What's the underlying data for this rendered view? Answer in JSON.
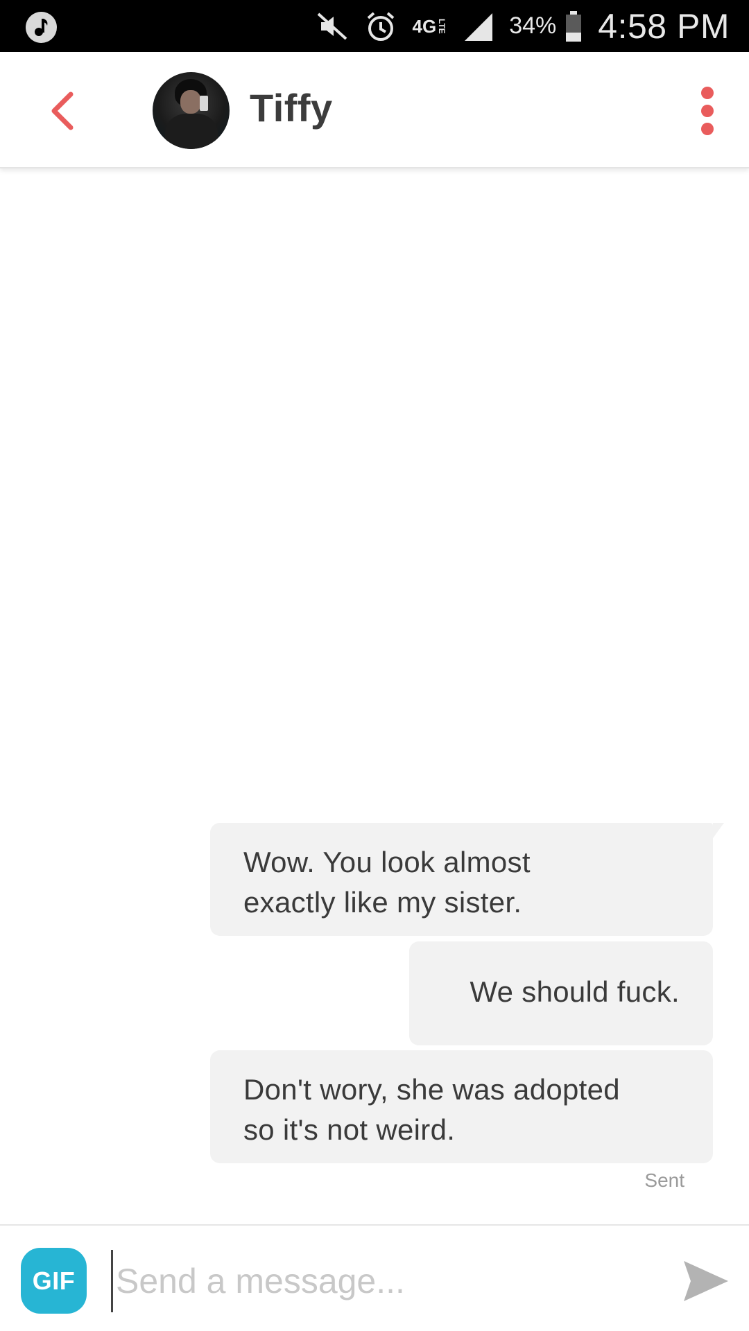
{
  "status_bar": {
    "music_icon": "music-note-icon",
    "mute_icon": "mute-icon",
    "alarm_icon": "alarm-icon",
    "network_label": "4G",
    "network_sub": "LTE",
    "signal_icon": "signal-icon",
    "battery_percent": "34%",
    "battery_level": 0.34,
    "time": "4:58 PM"
  },
  "header": {
    "back_icon": "chevron-left-icon",
    "contact_name": "Tiffy",
    "menu_icon": "more-vertical-icon"
  },
  "messages": [
    {
      "text_line1": "Wow. You look almost",
      "text_line2": "exactly like my sister."
    },
    {
      "text_line1": "We should fuck."
    },
    {
      "text_line1": "Don't wory, she was adopted",
      "text_line2": "so it's not weird."
    }
  ],
  "sent_label": "Sent",
  "composer": {
    "gif_label": "GIF",
    "placeholder": "Send a message...",
    "value": "",
    "send_icon": "send-icon"
  },
  "colors": {
    "accent": "#e95c5c",
    "gif": "#27b5d4",
    "bubble": "#f2f2f2",
    "text": "#3a3a3a"
  }
}
